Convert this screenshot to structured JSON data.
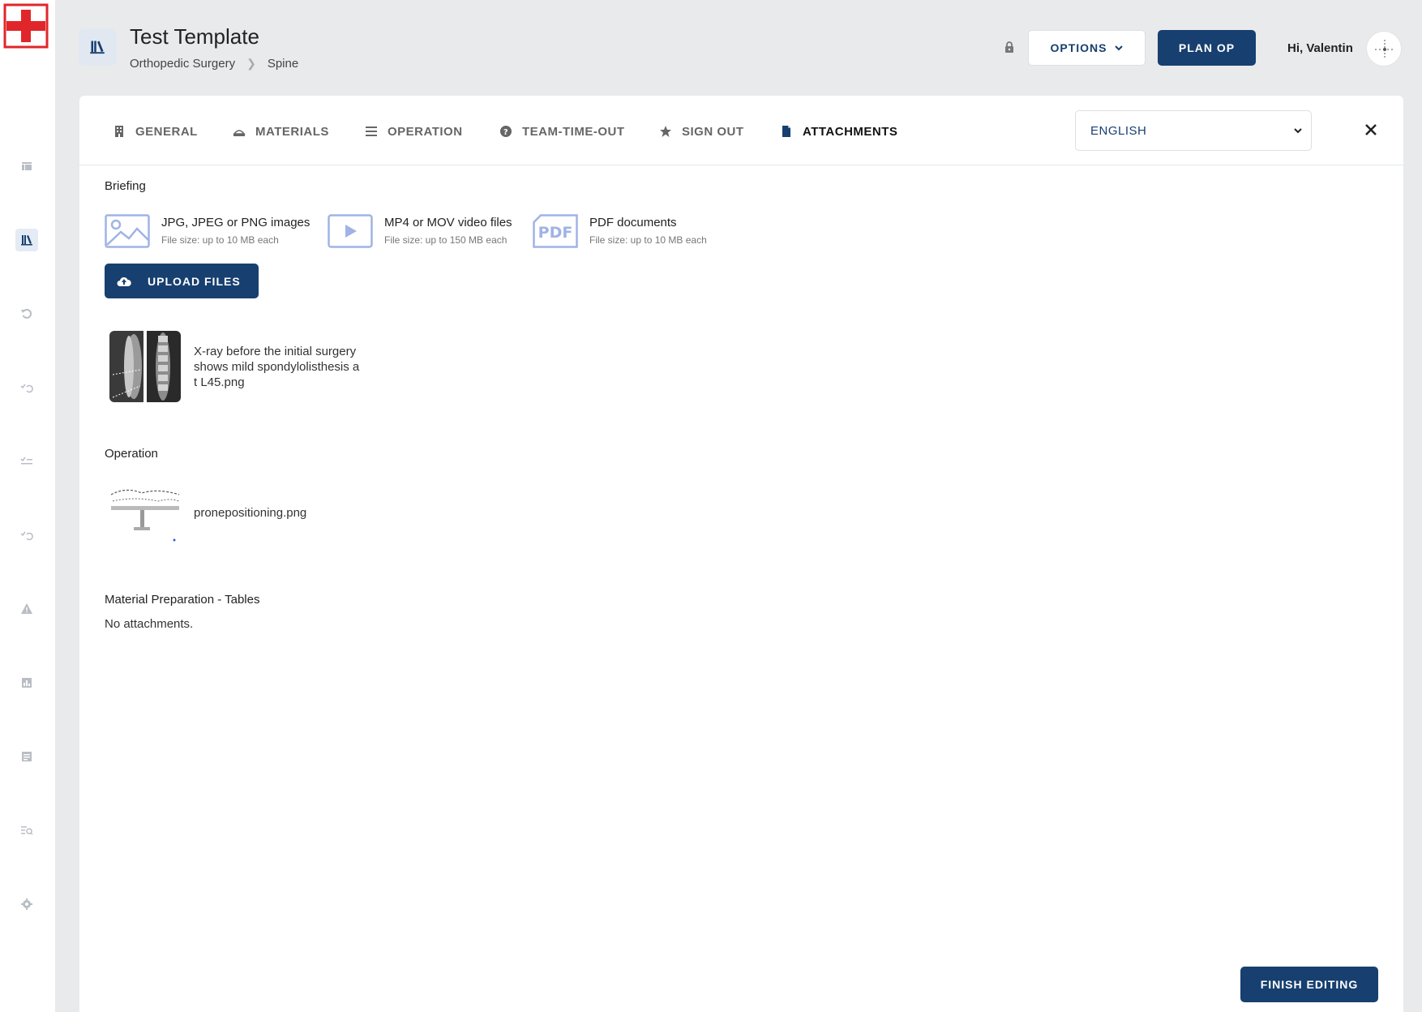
{
  "header": {
    "title": "Test Template",
    "breadcrumb": [
      "Orthopedic Surgery",
      "Spine"
    ],
    "options_label": "OPTIONS",
    "plan_label": "PLAN OP",
    "greeting": "Hi, Valentin"
  },
  "sidebar": {
    "items": [
      {
        "icon": "dashboard-icon",
        "active": false
      },
      {
        "icon": "library-icon",
        "active": true
      },
      {
        "icon": "history-icon",
        "active": false
      },
      {
        "icon": "checklist-history-icon",
        "active": false
      },
      {
        "icon": "checklist-icon",
        "active": false
      },
      {
        "icon": "checklist-reset-icon",
        "active": false
      },
      {
        "icon": "warning-icon",
        "active": false
      },
      {
        "icon": "statistics-icon",
        "active": false
      },
      {
        "icon": "report-icon",
        "active": false
      },
      {
        "icon": "search-list-icon",
        "active": false
      },
      {
        "icon": "settings-icon",
        "active": false
      }
    ]
  },
  "tabs": [
    {
      "label": "GENERAL",
      "icon": "building-icon",
      "active": false
    },
    {
      "label": "MATERIALS",
      "icon": "tray-icon",
      "active": false
    },
    {
      "label": "OPERATION",
      "icon": "list-icon",
      "active": false
    },
    {
      "label": "TEAM-TIME-OUT",
      "icon": "question-icon",
      "active": false
    },
    {
      "label": "SIGN OUT",
      "icon": "star-icon",
      "active": false
    },
    {
      "label": "ATTACHMENTS",
      "icon": "document-icon",
      "active": true
    }
  ],
  "language": {
    "selected": "ENGLISH"
  },
  "briefing": {
    "title": "Briefing",
    "file_types": [
      {
        "title": "JPG, JPEG or PNG images",
        "subtitle": "File size: up to 10 MB each",
        "icon": "image-icon"
      },
      {
        "title": "MP4 or MOV video files",
        "subtitle": "File size: up to 150 MB each",
        "icon": "video-icon"
      },
      {
        "title": "PDF documents",
        "subtitle": "File size: up to 10 MB each",
        "icon": "pdf-icon"
      }
    ],
    "upload_label": "UPLOAD FILES",
    "attachments": [
      {
        "name": "X-ray before the initial surgery shows mild spondylolisthesis at L45.png"
      }
    ]
  },
  "operation": {
    "title": "Operation",
    "attachments": [
      {
        "name": "pronepositioning.png"
      }
    ]
  },
  "material_prep": {
    "title": "Material Preparation - Tables",
    "empty_text": "No attachments."
  },
  "finish_label": "FINISH EDITING",
  "colors": {
    "primary": "#173f6f",
    "background": "#e9eaec",
    "accent_icon": "#9fb3e6",
    "logo_red": "#e0262a"
  }
}
